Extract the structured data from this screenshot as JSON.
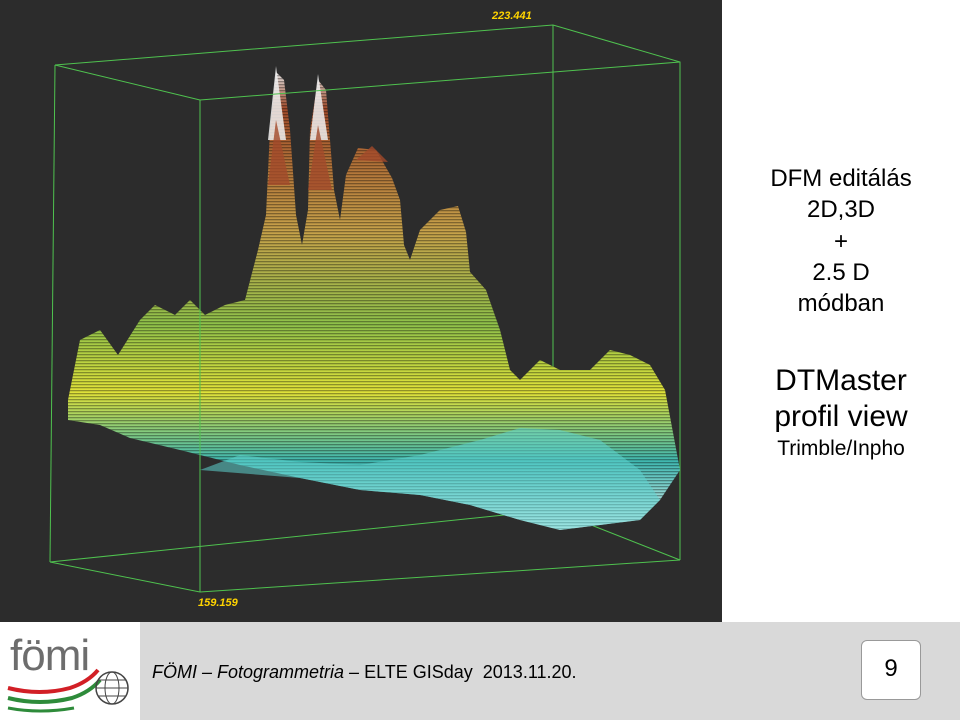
{
  "viewer": {
    "top_axis_label": "223.441",
    "bottom_axis_label": "159.159"
  },
  "right_panel": {
    "title_lines": [
      "DFM editálás",
      "2D,3D",
      "+",
      "2.5 D",
      "módban"
    ],
    "software_name": "DTMaster",
    "software_view": "profil view",
    "software_vendor": "Trimble/Inpho"
  },
  "footer": {
    "logo_text": "fömi",
    "citation_italic": "FÖMI – Fotogrammetria – ",
    "citation_plain": "ELTE GISday  2013.11.20.",
    "page_number": "9"
  },
  "colors": {
    "viewer_background": "#2c2c2c",
    "bounding_box": "#4fc24f",
    "axis_label": "#ffd400",
    "footer_background": "#d9d9d9",
    "flag_red": "#d21f26",
    "flag_green": "#2e8b3a"
  }
}
